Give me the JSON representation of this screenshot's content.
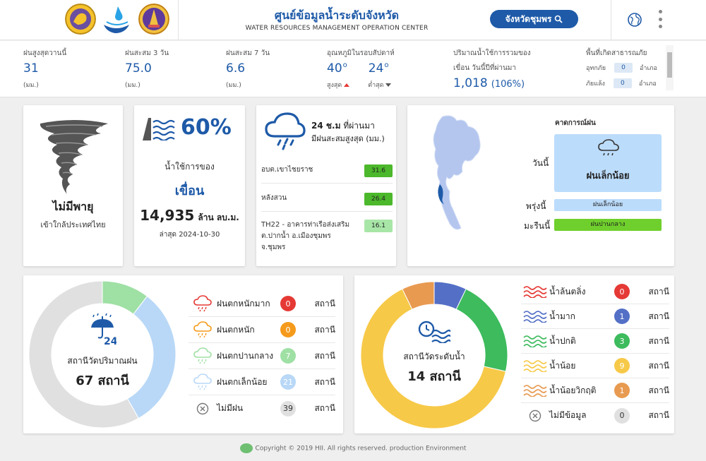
{
  "header": {
    "title": "ศูนย์ข้อมูลน้ำระดับจังหวัด",
    "subtitle": "WATER RESOURCES MANAGEMENT OPERATION CENTER",
    "province_button": "จังหวัดชุมพร",
    "icons": [
      "province-seal-logo",
      "water-logo",
      "temple-logo",
      "search-icon",
      "globe-icon",
      "kebab-menu-icon"
    ]
  },
  "stats": {
    "rain_today": {
      "label": "ฝนสูงสุดวานนี้",
      "value": "31",
      "unit": "(มม.)"
    },
    "rain_3d": {
      "label": "ฝนสะสม 3 วัน",
      "value": "75.0",
      "unit": "(มม.)"
    },
    "rain_7d": {
      "label": "ฝนสะสม 7 วัน",
      "value": "6.6",
      "unit": "(มม.)"
    },
    "temp": {
      "label": "อุณหภูมิในรอบสัปดาห์",
      "max": "40",
      "min": "24",
      "deg": "o",
      "max_label": "สูงสุด",
      "min_label": "ต่ำสุด"
    },
    "dam": {
      "label1": "ปริมาณน้ำใช้การรวมของ",
      "label2": "เขื่อน วันนี้ปีที่ผ่านมา",
      "value": "1,018",
      "pct": "(106%)"
    },
    "disaster": {
      "label": "พื้นที่เกิดสาธารณภัย",
      "flood_label": "อุทกภัย",
      "flood_count": "0",
      "drought_label": "ภัยแล้ง",
      "drought_count": "0",
      "unit": "อำเภอ"
    }
  },
  "storm": {
    "title": "ไม่มีพายุ",
    "sub": "เข้าใกล้ประเทศไทย"
  },
  "dam_card": {
    "pct": "60%",
    "line1": "น้ำใช้การของ",
    "line2": "เขื่อน",
    "volume": "14,935",
    "unit": "ล้าน ลบ.ม.",
    "updated": "ล่าสุด 2024-10-30"
  },
  "rain24": {
    "title_bold": "24 ช.ม",
    "title_rest": " ที่ผ่านมา",
    "title2": "มีฝนสะสมสูงสุด (มม.)",
    "rows": [
      {
        "name": "อบต.เขาไชยราช",
        "value": "31.6",
        "color": "#4cb82b"
      },
      {
        "name": "หลังสวน",
        "value": "26.4",
        "color": "#4cb82b"
      },
      {
        "name": "TH22 - อาคารท่าเรือส่งเสริม ต.ปากน้ำ อ.เมืองชุมพร จ.ชุมพร",
        "value": "16.1",
        "color": "#a8e6a8"
      }
    ]
  },
  "forecast": {
    "title": "คาดการณ์ฝน",
    "today_label": "วันนี้",
    "today_text": "ฝนเล็กน้อย",
    "tomorrow_label": "พรุ่งนี้",
    "tomorrow_text": "ฝนเล็กน้อย",
    "after_label": "มะรืนนี้",
    "after_text": "ฝนปานกลาง",
    "colors": {
      "light": "#bcdcfb",
      "moderate": "#6fcf2c"
    }
  },
  "rain_stations": {
    "label": "สถานีวัดปริมาณฝน",
    "total": "67 สถานี",
    "icon_text": "24",
    "station_word": "สถานี",
    "legend": [
      {
        "label": "ฝนตกหนักมาก",
        "count": "0",
        "color": "#e53935",
        "icon": "heavy-rain-cloud-icon"
      },
      {
        "label": "ฝนตกหนัก",
        "count": "0",
        "color": "#f59a1b",
        "icon": "rain-cloud-icon"
      },
      {
        "label": "ฝนตกปานกลาง",
        "count": "7",
        "color": "#9fe0a4",
        "icon": "moderate-rain-cloud-icon"
      },
      {
        "label": "ฝนตกเล็กน้อย",
        "count": "21",
        "color": "#b9d8f7",
        "icon": "light-rain-cloud-icon"
      },
      {
        "label": "ไม่มีฝน",
        "count": "39",
        "color": "#e0e0e0",
        "icon": "no-rain-icon"
      }
    ]
  },
  "water_stations": {
    "label": "สถานีวัดระดับน้ำ",
    "total": "14 สถานี",
    "station_word": "สถานี",
    "legend": [
      {
        "label": "น้ำล้นตลิ่ง",
        "count": "0",
        "color": "#e53935",
        "icon": "overflow-wave-icon"
      },
      {
        "label": "น้ำมาก",
        "count": "1",
        "color": "#5470c6",
        "icon": "high-water-wave-icon"
      },
      {
        "label": "น้ำปกติ",
        "count": "3",
        "color": "#3dbb5d",
        "icon": "normal-water-wave-icon"
      },
      {
        "label": "น้ำน้อย",
        "count": "9",
        "color": "#f7c948",
        "icon": "low-water-wave-icon"
      },
      {
        "label": "น้ำน้อยวิกฤติ",
        "count": "1",
        "color": "#e89a50",
        "icon": "critical-low-wave-icon"
      },
      {
        "label": "ไม่มีข้อมูล",
        "count": "0",
        "color": "#e0e0e0",
        "icon": "no-data-icon"
      }
    ]
  },
  "chart_data": [
    {
      "type": "pie",
      "title": "สถานีวัดปริมาณฝน",
      "labels": [
        "ฝนตกหนักมาก",
        "ฝนตกหนัก",
        "ฝนตกปานกลาง",
        "ฝนตกเล็กน้อย",
        "ไม่มีฝน"
      ],
      "values": [
        0,
        0,
        7,
        21,
        39
      ]
    },
    {
      "type": "pie",
      "title": "สถานีวัดระดับน้ำ",
      "labels": [
        "น้ำล้นตลิ่ง",
        "น้ำมาก",
        "น้ำปกติ",
        "น้ำน้อย",
        "น้ำน้อยวิกฤติ",
        "ไม่มีข้อมูล"
      ],
      "values": [
        0,
        1,
        3,
        9,
        1,
        0
      ]
    }
  ],
  "footer": {
    "text": "Copyright © 2019 HII. All rights reserved. production Environment"
  }
}
